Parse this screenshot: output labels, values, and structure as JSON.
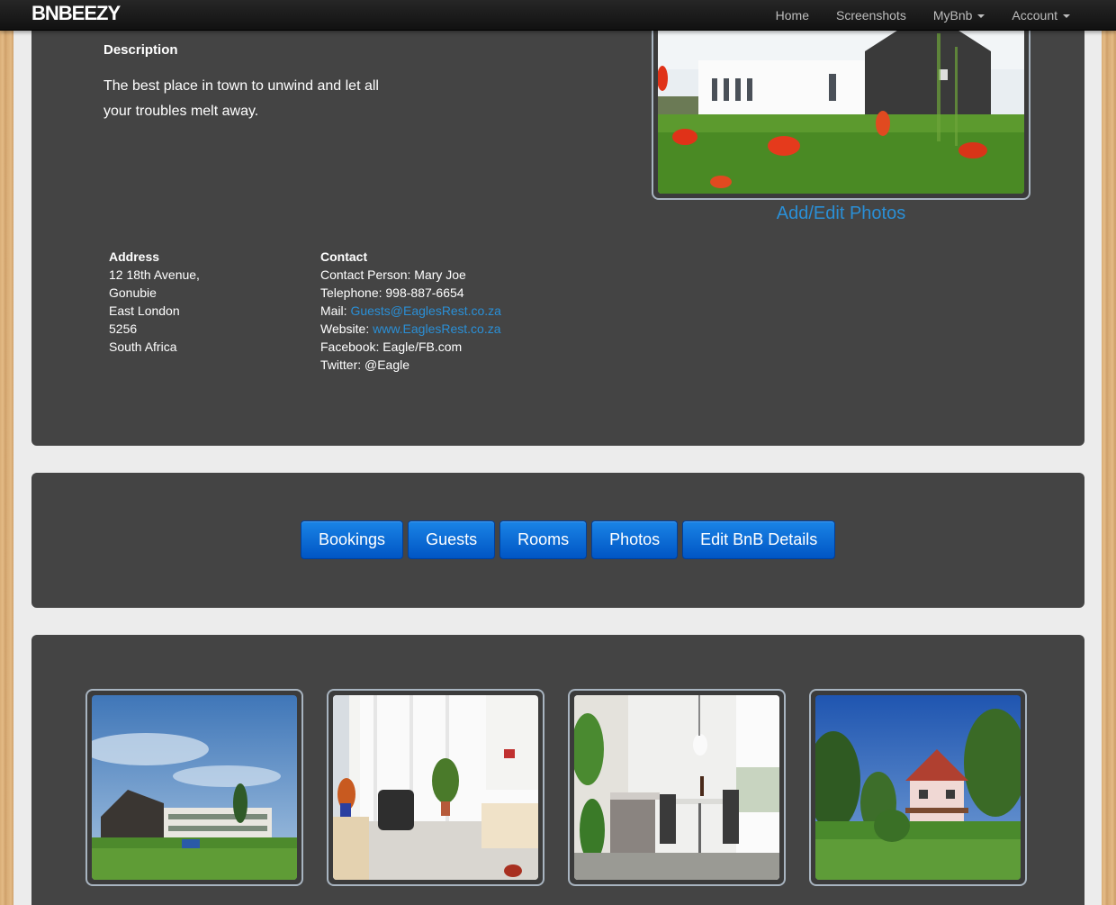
{
  "navbar": {
    "brand": "BNBEEZY",
    "items": [
      {
        "label": "Home"
      },
      {
        "label": "Screenshots"
      },
      {
        "label": "MyBnb"
      },
      {
        "label": "Account"
      }
    ]
  },
  "description": {
    "heading": "Description",
    "text": "The best place in town to unwind and let all your troubles melt away."
  },
  "photos_link": "Add/Edit Photos",
  "address": {
    "heading": "Address",
    "lines": [
      "12 18th Avenue,",
      "Gonubie",
      "East London",
      "5256",
      "South Africa"
    ]
  },
  "contact": {
    "heading": "Contact",
    "person": "Contact Person: Mary Joe",
    "telephone": "Telephone: 998-887-6654",
    "mail_label": "Mail: ",
    "mail": "Guests@EaglesRest.co.za",
    "website_label": "Website: ",
    "website": "www.EaglesRest.co.za",
    "facebook": "Facebook: Eagle/FB.com",
    "twitter": "Twitter: @Eagle"
  },
  "actions": [
    {
      "label": "Bookings"
    },
    {
      "label": "Guests"
    },
    {
      "label": "Rooms"
    },
    {
      "label": "Photos"
    },
    {
      "label": "Edit BnB Details"
    }
  ],
  "colors": {
    "panel": "#444444",
    "link": "#2a8fd6",
    "button": "#0a6ad8",
    "navbar": "#1b1b1b"
  }
}
